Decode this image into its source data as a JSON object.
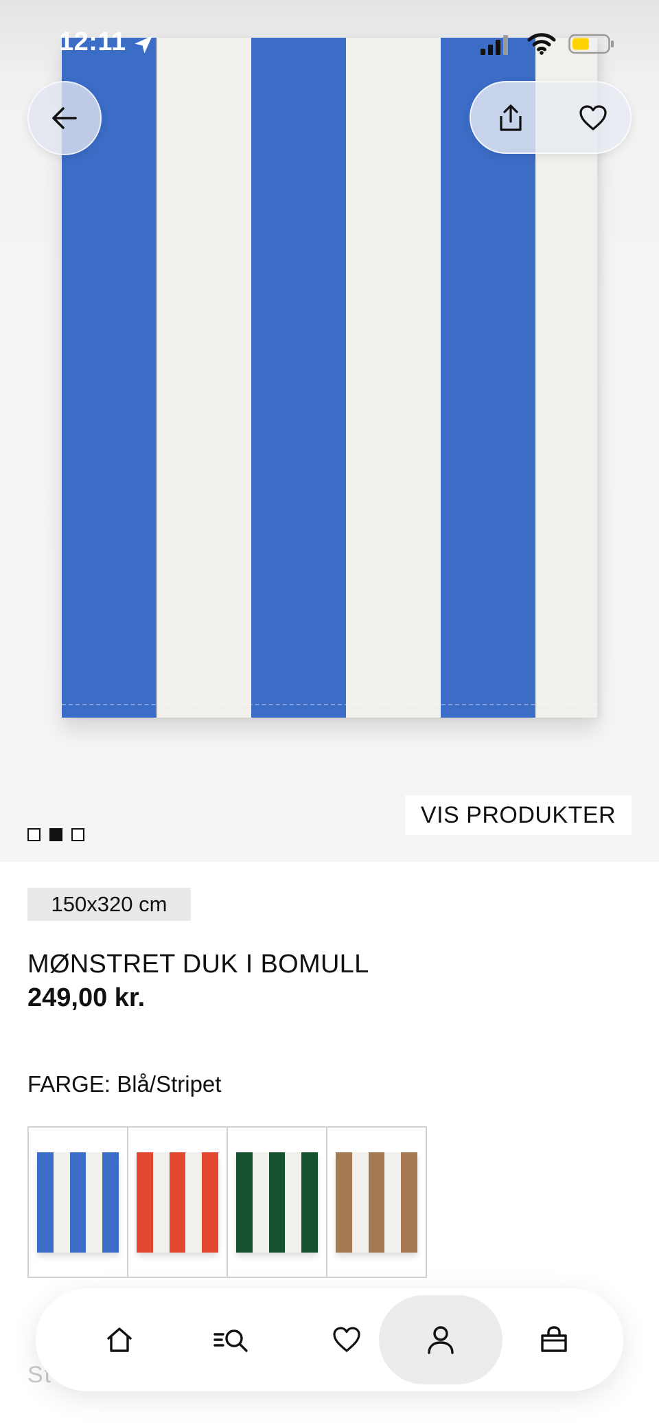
{
  "status_bar": {
    "time": "12:11",
    "icons": [
      "location-arrow-icon",
      "signal-icon",
      "wifi-icon",
      "battery-icon"
    ],
    "battery_color": "#ffd400"
  },
  "gallery": {
    "image": "blue-white-striped-tablecloth",
    "stripe_colors": [
      "#3b6cc6",
      "#f1f0ec"
    ],
    "current_index": 2,
    "total": 3,
    "vis_produkter_label": "VIS PRODUKTER"
  },
  "header": {
    "back_icon": "arrow-left-icon",
    "share_icon": "share-icon",
    "favorite_icon": "heart-icon"
  },
  "product": {
    "size": "150x320 cm",
    "title": "MØNSTRET DUK I BOMULL",
    "price": "249,00 kr.",
    "color_label": "FARGE: ",
    "color_value": "Blå/Stripet",
    "variants": [
      {
        "name": "Blå/Stripet",
        "colors": [
          "#3b6cc6",
          "#f1f0ec"
        ]
      },
      {
        "name": "Rød/Stripet",
        "colors": [
          "#e2482f",
          "#f1f0ec"
        ]
      },
      {
        "name": "Grønn/Stripet",
        "colors": [
          "#17502e",
          "#f1f0ec"
        ]
      },
      {
        "name": "Brun/Stripet",
        "colors": [
          "#a57a52",
          "#f1f0ec"
        ]
      }
    ]
  },
  "tabbar": {
    "items": [
      {
        "name": "home",
        "icon": "home-icon"
      },
      {
        "name": "search",
        "icon": "search-icon"
      },
      {
        "name": "favorites",
        "icon": "heart-icon"
      },
      {
        "name": "account",
        "icon": "user-icon",
        "active": true
      },
      {
        "name": "bag",
        "icon": "bag-icon"
      }
    ]
  }
}
